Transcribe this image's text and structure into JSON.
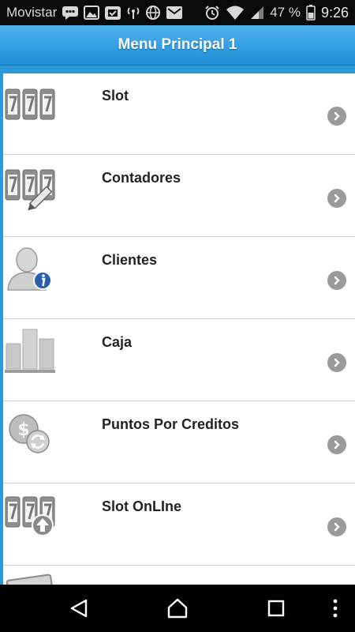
{
  "status_bar": {
    "carrier": "Movistar",
    "battery": "47 %",
    "time": "9:26",
    "icons": [
      "chat-icon",
      "image-icon",
      "clipboard-icon",
      "broadcast-icon",
      "globe-icon",
      "mail-icon",
      "alarm-icon",
      "wifi-icon",
      "signal-icon",
      "battery-icon"
    ]
  },
  "header": {
    "title": "Menu Principal 1",
    "color": "#2a9ad9"
  },
  "menu": {
    "items": [
      {
        "label": "Slot",
        "icon": "slot-machine-icon"
      },
      {
        "label": "Contadores",
        "icon": "slot-edit-icon"
      },
      {
        "label": "Clientes",
        "icon": "user-info-icon"
      },
      {
        "label": "Caja",
        "icon": "bar-chart-icon"
      },
      {
        "label": "Puntos Por Creditos",
        "icon": "coin-exchange-icon"
      },
      {
        "label": "Slot OnLIne",
        "icon": "slot-upload-icon"
      }
    ]
  },
  "nav_bar": {
    "buttons": [
      "back-icon",
      "home-icon",
      "recents-icon",
      "more-icon"
    ]
  }
}
